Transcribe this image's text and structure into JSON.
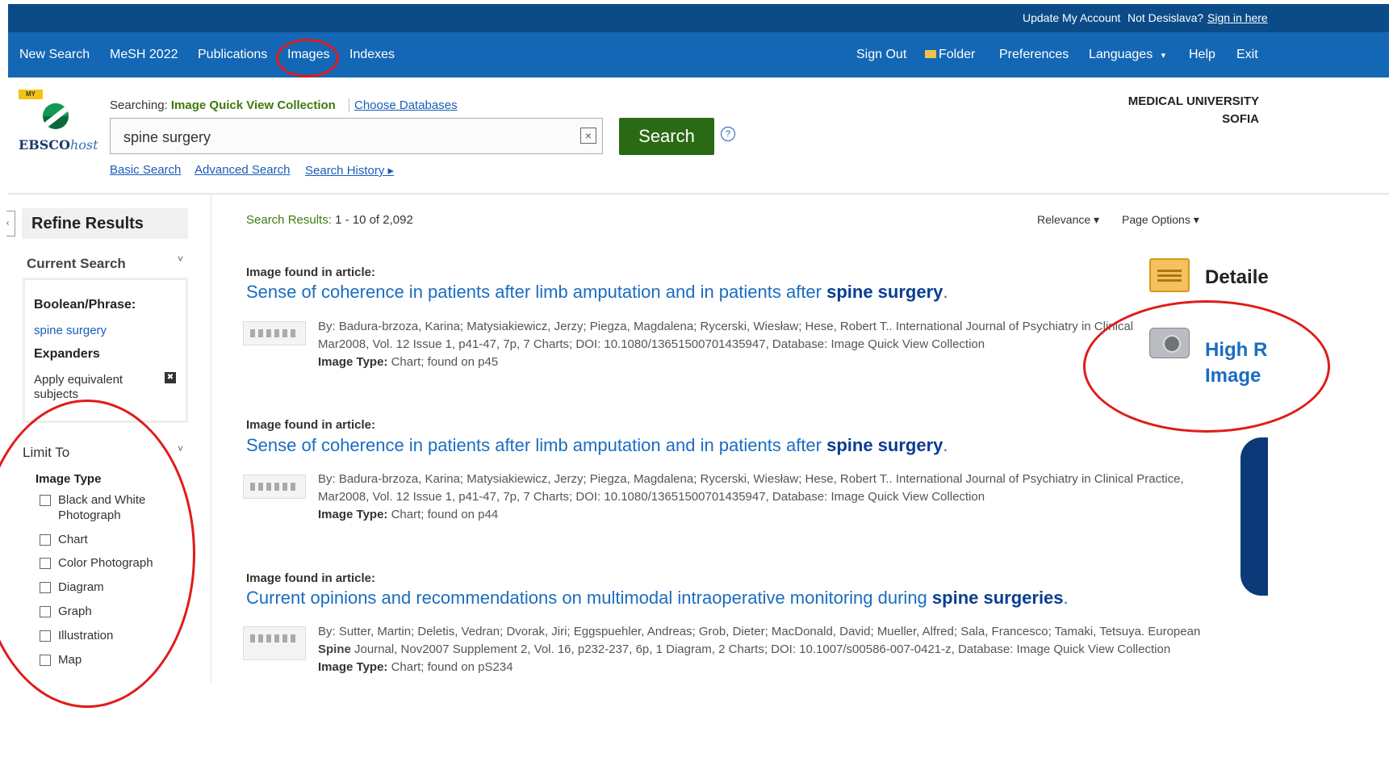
{
  "utility": {
    "update_account": "Update My Account",
    "not_user": "Not Desislava?",
    "sign_in": "Sign in here"
  },
  "nav": {
    "items": [
      "New Search",
      "MeSH 2022",
      "Publications",
      "Images",
      "Indexes"
    ],
    "right": {
      "sign_out": "Sign Out",
      "folder": "Folder",
      "preferences": "Preferences",
      "languages": "Languages",
      "languages_caret": "▾",
      "help": "Help",
      "exit": "Exit"
    }
  },
  "header": {
    "logo_my": "MY",
    "logo_main": "EBSCO",
    "logo_host": "host",
    "searching_label": "Searching:",
    "database": "Image Quick View Collection",
    "choose_databases": "Choose Databases",
    "query": "spine surgery",
    "clear_symbol": "×",
    "search_button": "Search",
    "help_symbol": "?",
    "basic_search": "Basic Search",
    "advanced_search": "Advanced Search",
    "search_history": "Search History ▸",
    "institution_line1": "MEDICAL UNIVERSITY",
    "institution_line2": "SOFIA"
  },
  "sidebar": {
    "collapse": "‹",
    "refine_title": "Refine Results",
    "current_search": "Current Search",
    "chevron": "˅",
    "boolean_label": "Boolean/Phrase:",
    "boolean_value": "spine surgery",
    "expanders_label": "Expanders",
    "expander_value": "Apply equivalent subjects",
    "remove_symbol": "✖",
    "limit_to": "Limit To",
    "image_type_label": "Image Type",
    "image_types": [
      "Black and White Photograph",
      "Chart",
      "Color Photograph",
      "Diagram",
      "Graph",
      "Illustration",
      "Map"
    ]
  },
  "results": {
    "count_label": "Search Results:",
    "count_value": "1 - 10 of 2,092",
    "relevance": "Relevance ▾",
    "page_options": "Page Options ▾",
    "items": [
      {
        "found": "Image found in article:",
        "title_pre": "Sense of coherence in patients after limb amputation and in patients after ",
        "title_hl": "spine surgery",
        "title_post": ".",
        "line1": "By: Badura-brzoza, Karina; Matysiakiewicz, Jerzy; Piegza, Magdalena; Rycerski, Wiesław; Hese, Robert T.. International Journal of Psychiatry in Clinical",
        "line2": "Mar2008, Vol. 12 Issue 1, p41-47, 7p, 7 Charts; DOI: 10.1080/13651500701435947, Database: Image Quick View Collection",
        "type_label": "Image Type:",
        "type_value": " Chart; found on p45"
      },
      {
        "found": "Image found in article:",
        "title_pre": "Sense of coherence in patients after limb amputation and in patients after ",
        "title_hl": "spine surgery",
        "title_post": ".",
        "line1": "By: Badura-brzoza, Karina; Matysiakiewicz, Jerzy; Piegza, Magdalena; Rycerski, Wiesław; Hese, Robert T.. International Journal of Psychiatry in Clinical Practice,",
        "line2": "Mar2008, Vol. 12 Issue 1, p41-47, 7p, 7 Charts; DOI: 10.1080/13651500701435947, Database: Image Quick View Collection",
        "type_label": "Image Type:",
        "type_value": " Chart; found on p44"
      },
      {
        "found": "Image found in article:",
        "title_pre": "Current opinions and recommendations on multimodal intraoperative monitoring during ",
        "title_hl": "spine surgeries",
        "title_post": ".",
        "line1": "By: Sutter, Martin; Deletis, Vedran; Dvorak, Jiri; Eggspuehler, Andreas; Grob, Dieter; MacDonald, David; Mueller, Alfred; Sala, Francesco; Tamaki, Tetsuya. European",
        "line2_bold": "Spine",
        "line2": " Journal, Nov2007 Supplement 2, Vol. 16, p232-237, 6p, 1 Diagram, 2 Charts; DOI: 10.1007/s00586-007-0421-z, Database: Image Quick View Collection",
        "type_label": "Image Type:",
        "type_value": " Chart; found on pS234"
      }
    ]
  },
  "right_panel": {
    "detailed": "Detaile",
    "hires_line1": "High R",
    "hires_line2": "Image"
  },
  "colors": {
    "utility_bar": "#0b4b87",
    "nav_bar": "#1467b5",
    "search_button": "#2a6a14",
    "link": "#1a6dc0",
    "annotation_ring": "#e01b1b"
  }
}
